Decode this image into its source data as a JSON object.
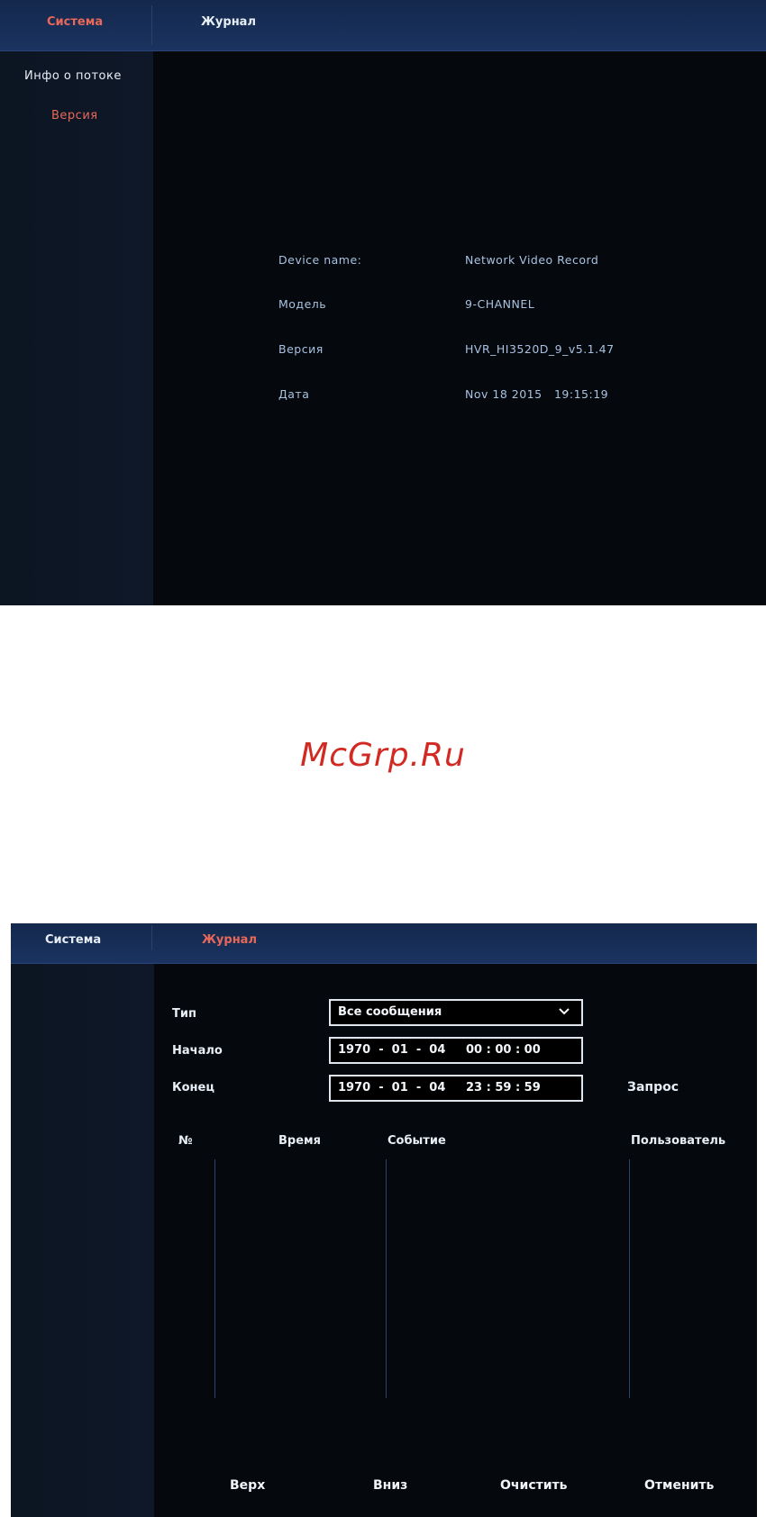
{
  "screen1": {
    "tabs": [
      {
        "label": "Система",
        "active": true
      },
      {
        "label": "Журнал",
        "active": false
      }
    ],
    "sidebar": [
      {
        "label": "Инфо о потоке",
        "active": false
      },
      {
        "label": "Версия",
        "active": true
      }
    ],
    "info": [
      {
        "label": "Device name:",
        "value": "Network Video Record"
      },
      {
        "label": "Модель",
        "value": "9-CHANNEL"
      },
      {
        "label": "Версия",
        "value": "HVR_HI3520D_9_v5.1.47"
      },
      {
        "label": "Дата",
        "value": "Nov 18 2015   19:15:19"
      }
    ]
  },
  "watermark": "McGrp.Ru",
  "screen2": {
    "tabs": [
      {
        "label": "Система",
        "active": false
      },
      {
        "label": "Журнал",
        "active": true
      }
    ],
    "form": {
      "type_label": "Тип",
      "type_value": "Все сообщения",
      "start_label": "Начало",
      "start_value": "1970  -  01  -  04     00 : 00 : 00",
      "end_label": "Конец",
      "end_value": "1970  -  01  -  04     23 : 59 : 59",
      "query_label": "Запрос"
    },
    "columns": [
      "№",
      "Время",
      "Событие",
      "Пользователь"
    ],
    "buttons": {
      "top": "Верх",
      "down": "Вниз",
      "clear": "Очистить",
      "cancel": "Отменить"
    }
  },
  "colors": {
    "accent": "#e8685a",
    "info_text": "#a9c2e2",
    "topbar": "#1a3360",
    "watermark": "#d22a22"
  }
}
